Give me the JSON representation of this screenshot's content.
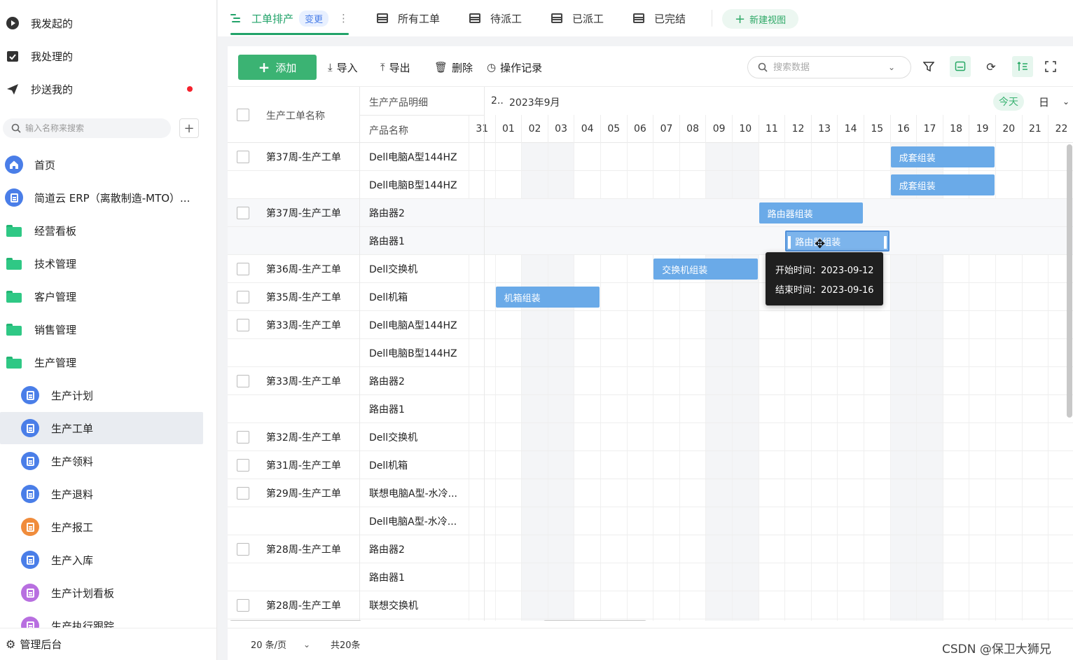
{
  "sidebar": {
    "top_items": [
      {
        "label": "我发起的",
        "icon": "play-circle-icon"
      },
      {
        "label": "我处理的",
        "icon": "check-box-icon"
      },
      {
        "label": "抄送我的",
        "icon": "paper-plane-icon"
      }
    ],
    "search_placeholder": "输入名称来搜索",
    "add_label": "+",
    "nav": [
      {
        "label": "首页",
        "icon": "home-icon",
        "color": "#4a7ee8",
        "indent": false
      },
      {
        "label": "简道云 ERP（离散制造-MTO）...",
        "icon": "app-icon",
        "color": "#4a7ee8",
        "indent": false
      },
      {
        "label": "经营看板",
        "icon": "folder-icon",
        "indent": false
      },
      {
        "label": "技术管理",
        "icon": "folder-icon",
        "indent": false
      },
      {
        "label": "客户管理",
        "icon": "folder-icon",
        "indent": false
      },
      {
        "label": "销售管理",
        "icon": "folder-icon",
        "indent": false
      },
      {
        "label": "生产管理",
        "icon": "folder-open-icon",
        "indent": false
      },
      {
        "label": "生产计划",
        "icon": "form-icon",
        "color": "#4a7ee8",
        "indent": true
      },
      {
        "label": "生产工单",
        "icon": "form-icon",
        "color": "#4a7ee8",
        "indent": true,
        "active": true
      },
      {
        "label": "生产领料",
        "icon": "form-icon",
        "color": "#4a7ee8",
        "indent": true
      },
      {
        "label": "生产退料",
        "icon": "form-icon",
        "color": "#4a7ee8",
        "indent": true
      },
      {
        "label": "生产报工",
        "icon": "form-icon",
        "color": "#f08c3c",
        "indent": true
      },
      {
        "label": "生产入库",
        "icon": "form-icon",
        "color": "#4a7ee8",
        "indent": true
      },
      {
        "label": "生产计划看板",
        "icon": "dashboard-icon",
        "color": "#b86fe0",
        "indent": true
      },
      {
        "label": "生产执行跟踪",
        "icon": "dashboard-icon",
        "color": "#b86fe0",
        "indent": true
      }
    ],
    "admin_label": "管理后台"
  },
  "viewbar": {
    "tabs": [
      {
        "label": "工单排产",
        "active": true,
        "badge": "变更"
      },
      {
        "label": "所有工单"
      },
      {
        "label": "待派工"
      },
      {
        "label": "已派工"
      },
      {
        "label": "已完结"
      }
    ],
    "more": "⋮",
    "new_view": "新建视图"
  },
  "toolbar": {
    "add": "添加",
    "import": "导入",
    "export": "导出",
    "delete": "删除",
    "log": "操作记录",
    "search_placeholder": "搜索数据"
  },
  "table": {
    "col_name": "生产工单名称",
    "col_detail": "生产产品明细",
    "col_product": "产品名称",
    "month_prefix": "2..",
    "month": "2023年9月",
    "today": "今天",
    "scale": "日",
    "days": [
      "31",
      "01",
      "02",
      "03",
      "04",
      "05",
      "06",
      "07",
      "08",
      "09",
      "10",
      "11",
      "12",
      "13",
      "14",
      "15",
      "16",
      "17",
      "18",
      "19",
      "20",
      "21",
      "22"
    ],
    "rows": [
      {
        "name": "第37周-生产工单",
        "product": "Dell电脑A型144HZ",
        "cb": true
      },
      {
        "name": "",
        "product": "Dell电脑B型144HZ",
        "cb": false
      },
      {
        "name": "第37周-生产工单",
        "product": "路由器2",
        "cb": true,
        "hl": true
      },
      {
        "name": "",
        "product": "路由器1",
        "cb": false,
        "hl": true
      },
      {
        "name": "第36周-生产工单",
        "product": "Dell交换机",
        "cb": true
      },
      {
        "name": "第35周-生产工单",
        "product": "Dell机箱",
        "cb": true
      },
      {
        "name": "第33周-生产工单",
        "product": "Dell电脑A型144HZ",
        "cb": true
      },
      {
        "name": "",
        "product": "Dell电脑B型144HZ",
        "cb": false
      },
      {
        "name": "第33周-生产工单",
        "product": "路由器2",
        "cb": true
      },
      {
        "name": "",
        "product": "路由器1",
        "cb": false
      },
      {
        "name": "第32周-生产工单",
        "product": "Dell交换机",
        "cb": true
      },
      {
        "name": "第31周-生产工单",
        "product": "Dell机箱",
        "cb": true
      },
      {
        "name": "第29周-生产工单",
        "product": "联想电脑A型-水冷...",
        "cb": true
      },
      {
        "name": "",
        "product": "Dell电脑A型-水冷...",
        "cb": false
      },
      {
        "name": "第28周-生产工单",
        "product": "路由器2",
        "cb": true
      },
      {
        "name": "",
        "product": "路由器1",
        "cb": false
      },
      {
        "name": "第28周-生产工单",
        "product": "联想交换机",
        "cb": true
      }
    ],
    "bars": [
      {
        "label": "成套组装",
        "row": 0,
        "start": 16,
        "end": 20
      },
      {
        "label": "成套组装",
        "row": 1,
        "start": 16,
        "end": 20
      },
      {
        "label": "路由器组装",
        "row": 2,
        "start": 11,
        "end": 15
      },
      {
        "label": "路由器组装",
        "row": 3,
        "start": 12,
        "end": 16,
        "selected": true
      },
      {
        "label": "交换机组装",
        "row": 4,
        "start": 7,
        "end": 11
      },
      {
        "label": "机箱组装",
        "row": 5,
        "start": 1,
        "end": 5
      }
    ],
    "tooltip": {
      "start": "开始时间：2023-09-12",
      "end": "结束时间：2023-09-16"
    }
  },
  "footer": {
    "page_size": "20 条/页",
    "total": "共20条"
  },
  "watermark": "CSDN @保卫大狮兄",
  "colors": {
    "accent": "#3bb373",
    "bar": "#6aaae8"
  }
}
